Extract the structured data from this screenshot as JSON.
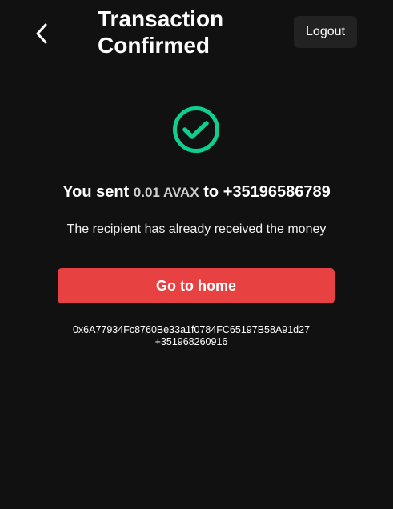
{
  "header": {
    "title": "Transaction Confirmed",
    "logout_label": "Logout",
    "back_icon": "chevron-left-icon"
  },
  "status": {
    "icon": "check-circle-icon",
    "icon_color": "#0fcf8f"
  },
  "summary": {
    "prefix": "You sent",
    "amount": "0.01 AVAX",
    "to_word": "to",
    "recipient": "+35196586789"
  },
  "note": "The recipient has already received the money",
  "actions": {
    "home_label": "Go to home",
    "home_color": "#e84142"
  },
  "details": {
    "tx_hash": "0x6A77934Fc8760Be33a1f0784FC65197B58A91d27",
    "phone": "+351968260916"
  }
}
